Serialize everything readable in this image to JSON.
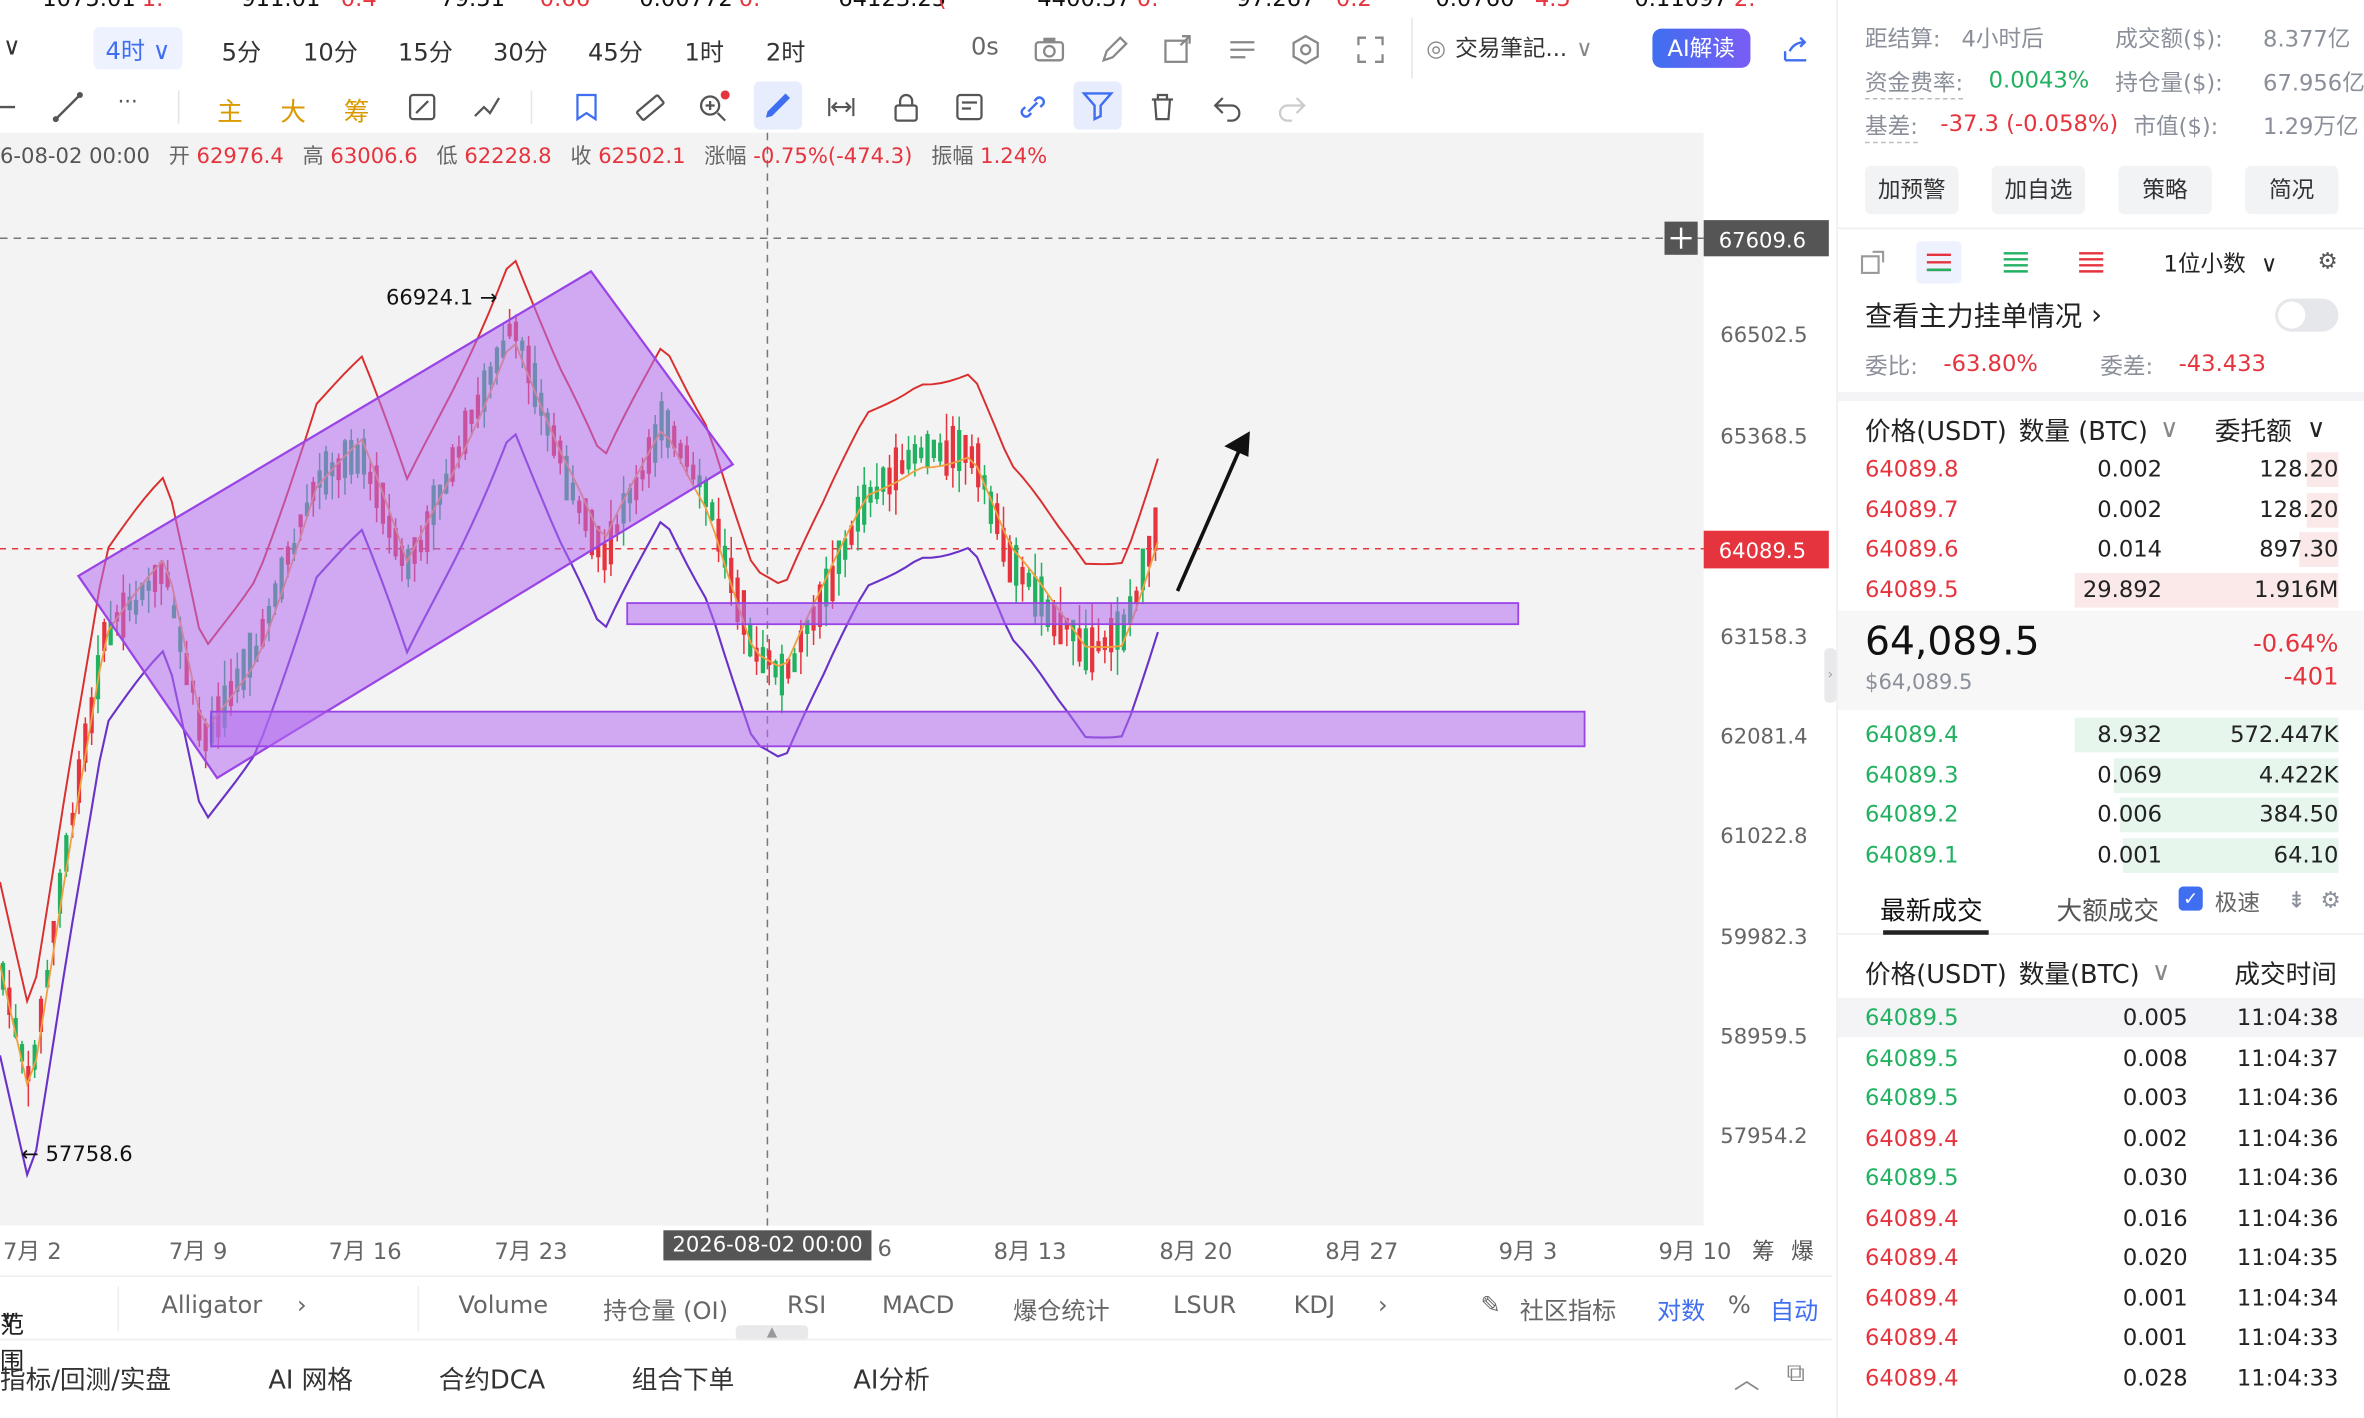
{
  "ticker_strip": [
    "1075.01",
    "1.",
    "911.01",
    "0.4",
    "79.51",
    "0.66",
    "0.00772",
    "0.",
    "64123.25",
    "(",
    "4400.37",
    "0.",
    "97.267",
    "0.2",
    "0.0760",
    "4.5",
    "0.11097",
    "2."
  ],
  "timeframes": {
    "active": "4时",
    "items": [
      "5分",
      "10分",
      "15分",
      "30分",
      "45分",
      "1时",
      "2时"
    ],
    "ticks": "0s"
  },
  "toolbar": {
    "trade_notes": "交易筆記...",
    "ai_label": "AI解读",
    "main": "主",
    "big": "大",
    "chip": "筹",
    "more": "···"
  },
  "ohlc": {
    "datetime": "6-08-02 00:00",
    "open_label": "开",
    "open": "62976.4",
    "high_label": "高",
    "high": "63006.6",
    "low_label": "低",
    "low": "62228.8",
    "close_label": "收",
    "close": "62502.1",
    "change_label": "涨幅",
    "change": "-0.75%(-474.3)",
    "amp_label": "振幅",
    "amp": "1.24%"
  },
  "price_axis": {
    "labels": [
      "66502.5",
      "65368.5",
      "63158.3",
      "62081.4",
      "61022.8",
      "59982.3",
      "58959.5",
      "57954.2"
    ],
    "crosshair_price": "67609.6",
    "last_price": "64089.5"
  },
  "annotations": {
    "high_note": "66924.1 →",
    "low_note": "← 57758.6"
  },
  "x_axis": {
    "labels": [
      "7月 2",
      "7月 9",
      "7月 16",
      "7月 23",
      "6",
      "8月 13",
      "8月 20",
      "8月 27",
      "9月 3",
      "9月 10"
    ],
    "cursor": "2026-08-02 00:00",
    "right1": "筹",
    "right2": "爆"
  },
  "indicator_tabs": {
    "range": "范围",
    "alligator": "Alligator",
    "items": [
      "Volume",
      "持仓量 (OI)",
      "RSI",
      "MACD",
      "爆仓统计",
      "LSUR",
      "KDJ"
    ],
    "community": "社区指标",
    "log": "对数",
    "pct": "%",
    "auto": "自动"
  },
  "bottom_bar": {
    "items": [
      "指标/回测/实盘",
      "AI 网格",
      "合约DCA",
      "组合下单",
      "AI分析"
    ]
  },
  "right_panel": {
    "settle_label": "距结算:",
    "settle": "4小时后",
    "turnover_label": "成交额($):",
    "turnover": "8.377亿",
    "funding_label": "资金费率:",
    "funding": "0.0043%",
    "oi_label": "持仓量($):",
    "oi": "67.956亿",
    "basis_label": "基差:",
    "basis": "-37.3 (-0.058%)",
    "mcap_label": "市值($):",
    "mcap": "1.29万亿",
    "buttons": [
      "加预警",
      "加自选",
      "策略",
      "简况"
    ],
    "decimals": "1位小数",
    "main_orders": "查看主力挂单情况",
    "ratio_label": "委比:",
    "ratio": "-63.80%",
    "diff_label": "委差:",
    "diff": "-43.433",
    "ob_headers": {
      "price": "价格(USDT)",
      "qty": "数量 (BTC)",
      "total": "委托额"
    },
    "asks": [
      {
        "p": "64089.8",
        "q": "0.002",
        "t": "128.20",
        "w": 0.12
      },
      {
        "p": "64089.7",
        "q": "0.002",
        "t": "128.20",
        "w": 0.12
      },
      {
        "p": "64089.6",
        "q": "0.014",
        "t": "897.30",
        "w": 0.15
      },
      {
        "p": "64089.5",
        "q": "29.892",
        "t": "1.916M",
        "w": 1.0
      }
    ],
    "last_price": "64,089.5",
    "last_usd": "$64,089.5",
    "change_pct": "-0.64%",
    "change_abs": "-401",
    "bids": [
      {
        "p": "64089.4",
        "q": "8.932",
        "t": "572.447K",
        "w": 1.0
      },
      {
        "p": "64089.3",
        "q": "0.069",
        "t": "4.422K",
        "w": 0.85
      },
      {
        "p": "64089.2",
        "q": "0.006",
        "t": "384.50",
        "w": 0.83
      },
      {
        "p": "64089.1",
        "q": "0.001",
        "t": "64.10",
        "w": 0.82
      }
    ],
    "trades_tab": "最新成交",
    "big_trades_tab": "大额成交",
    "fast_label": "极速",
    "trade_headers": {
      "price": "价格(USDT)",
      "qty": "数量(BTC)",
      "time": "成交时间"
    },
    "trades": [
      {
        "p": "64089.5",
        "q": "0.005",
        "t": "11:04:38",
        "side": "buy"
      },
      {
        "p": "64089.5",
        "q": "0.008",
        "t": "11:04:37",
        "side": "buy"
      },
      {
        "p": "64089.5",
        "q": "0.003",
        "t": "11:04:36",
        "side": "buy"
      },
      {
        "p": "64089.4",
        "q": "0.002",
        "t": "11:04:36",
        "side": "sell"
      },
      {
        "p": "64089.5",
        "q": "0.030",
        "t": "11:04:36",
        "side": "buy"
      },
      {
        "p": "64089.4",
        "q": "0.016",
        "t": "11:04:36",
        "side": "sell"
      },
      {
        "p": "64089.4",
        "q": "0.020",
        "t": "11:04:35",
        "side": "sell"
      },
      {
        "p": "64089.4",
        "q": "0.001",
        "t": "11:04:34",
        "side": "sell"
      },
      {
        "p": "64089.4",
        "q": "0.001",
        "t": "11:04:33",
        "side": "sell"
      },
      {
        "p": "64089.4",
        "q": "0.028",
        "t": "11:04:33",
        "side": "sell"
      }
    ]
  },
  "colors": {
    "up": "#21b160",
    "down": "#e5343d",
    "accent": "#3f6ff0",
    "zone": "#b26cf0"
  }
}
